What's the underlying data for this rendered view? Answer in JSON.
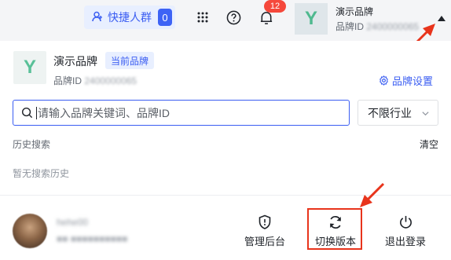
{
  "topbar": {
    "quick_crowd_label": "快捷人群",
    "quick_crowd_count": "0",
    "notification_count": "12",
    "brand_logo_letter": "Y",
    "brand_name": "演示品牌",
    "brand_id_label": "品牌ID",
    "brand_id_value": "2400000065"
  },
  "panel": {
    "brand_logo_letter": "Y",
    "brand_name": "演示品牌",
    "current_tag": "当前品牌",
    "brand_id_label": "品牌ID",
    "brand_id_value": "2400000065",
    "settings_label": "品牌设置",
    "search_placeholder": "请输入品牌关键词、品牌ID",
    "industry_value": "不限行业",
    "history_label": "历史搜索",
    "clear_label": "清空",
    "empty_history": "暂无搜索历史"
  },
  "user": {
    "name": "hehe00",
    "meta": "■■ ■■■■■■■■■■"
  },
  "actions": {
    "management": "管理后台",
    "switch_version": "切换版本",
    "logout": "退出登录"
  },
  "colors": {
    "accent": "#3a5df2",
    "annotation": "#e8341c",
    "badge": "#f5483b"
  }
}
